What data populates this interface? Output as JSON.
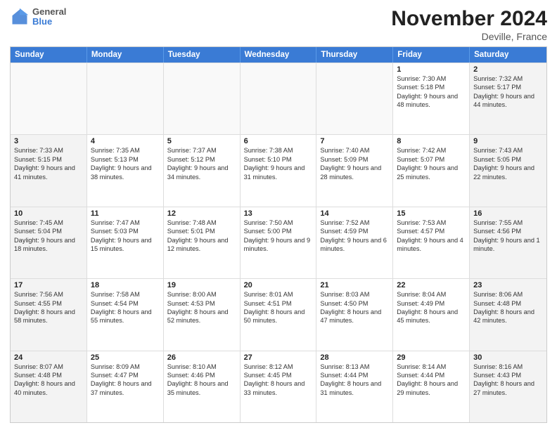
{
  "header": {
    "logo_line1": "General",
    "logo_line2": "Blue",
    "month": "November 2024",
    "location": "Deville, France"
  },
  "days_of_week": [
    "Sunday",
    "Monday",
    "Tuesday",
    "Wednesday",
    "Thursday",
    "Friday",
    "Saturday"
  ],
  "rows": [
    [
      {
        "day": "",
        "info": ""
      },
      {
        "day": "",
        "info": ""
      },
      {
        "day": "",
        "info": ""
      },
      {
        "day": "",
        "info": ""
      },
      {
        "day": "",
        "info": ""
      },
      {
        "day": "1",
        "info": "Sunrise: 7:30 AM\nSunset: 5:18 PM\nDaylight: 9 hours and 48 minutes."
      },
      {
        "day": "2",
        "info": "Sunrise: 7:32 AM\nSunset: 5:17 PM\nDaylight: 9 hours and 44 minutes."
      }
    ],
    [
      {
        "day": "3",
        "info": "Sunrise: 7:33 AM\nSunset: 5:15 PM\nDaylight: 9 hours and 41 minutes."
      },
      {
        "day": "4",
        "info": "Sunrise: 7:35 AM\nSunset: 5:13 PM\nDaylight: 9 hours and 38 minutes."
      },
      {
        "day": "5",
        "info": "Sunrise: 7:37 AM\nSunset: 5:12 PM\nDaylight: 9 hours and 34 minutes."
      },
      {
        "day": "6",
        "info": "Sunrise: 7:38 AM\nSunset: 5:10 PM\nDaylight: 9 hours and 31 minutes."
      },
      {
        "day": "7",
        "info": "Sunrise: 7:40 AM\nSunset: 5:09 PM\nDaylight: 9 hours and 28 minutes."
      },
      {
        "day": "8",
        "info": "Sunrise: 7:42 AM\nSunset: 5:07 PM\nDaylight: 9 hours and 25 minutes."
      },
      {
        "day": "9",
        "info": "Sunrise: 7:43 AM\nSunset: 5:05 PM\nDaylight: 9 hours and 22 minutes."
      }
    ],
    [
      {
        "day": "10",
        "info": "Sunrise: 7:45 AM\nSunset: 5:04 PM\nDaylight: 9 hours and 18 minutes."
      },
      {
        "day": "11",
        "info": "Sunrise: 7:47 AM\nSunset: 5:03 PM\nDaylight: 9 hours and 15 minutes."
      },
      {
        "day": "12",
        "info": "Sunrise: 7:48 AM\nSunset: 5:01 PM\nDaylight: 9 hours and 12 minutes."
      },
      {
        "day": "13",
        "info": "Sunrise: 7:50 AM\nSunset: 5:00 PM\nDaylight: 9 hours and 9 minutes."
      },
      {
        "day": "14",
        "info": "Sunrise: 7:52 AM\nSunset: 4:59 PM\nDaylight: 9 hours and 6 minutes."
      },
      {
        "day": "15",
        "info": "Sunrise: 7:53 AM\nSunset: 4:57 PM\nDaylight: 9 hours and 4 minutes."
      },
      {
        "day": "16",
        "info": "Sunrise: 7:55 AM\nSunset: 4:56 PM\nDaylight: 9 hours and 1 minute."
      }
    ],
    [
      {
        "day": "17",
        "info": "Sunrise: 7:56 AM\nSunset: 4:55 PM\nDaylight: 8 hours and 58 minutes."
      },
      {
        "day": "18",
        "info": "Sunrise: 7:58 AM\nSunset: 4:54 PM\nDaylight: 8 hours and 55 minutes."
      },
      {
        "day": "19",
        "info": "Sunrise: 8:00 AM\nSunset: 4:53 PM\nDaylight: 8 hours and 52 minutes."
      },
      {
        "day": "20",
        "info": "Sunrise: 8:01 AM\nSunset: 4:51 PM\nDaylight: 8 hours and 50 minutes."
      },
      {
        "day": "21",
        "info": "Sunrise: 8:03 AM\nSunset: 4:50 PM\nDaylight: 8 hours and 47 minutes."
      },
      {
        "day": "22",
        "info": "Sunrise: 8:04 AM\nSunset: 4:49 PM\nDaylight: 8 hours and 45 minutes."
      },
      {
        "day": "23",
        "info": "Sunrise: 8:06 AM\nSunset: 4:48 PM\nDaylight: 8 hours and 42 minutes."
      }
    ],
    [
      {
        "day": "24",
        "info": "Sunrise: 8:07 AM\nSunset: 4:48 PM\nDaylight: 8 hours and 40 minutes."
      },
      {
        "day": "25",
        "info": "Sunrise: 8:09 AM\nSunset: 4:47 PM\nDaylight: 8 hours and 37 minutes."
      },
      {
        "day": "26",
        "info": "Sunrise: 8:10 AM\nSunset: 4:46 PM\nDaylight: 8 hours and 35 minutes."
      },
      {
        "day": "27",
        "info": "Sunrise: 8:12 AM\nSunset: 4:45 PM\nDaylight: 8 hours and 33 minutes."
      },
      {
        "day": "28",
        "info": "Sunrise: 8:13 AM\nSunset: 4:44 PM\nDaylight: 8 hours and 31 minutes."
      },
      {
        "day": "29",
        "info": "Sunrise: 8:14 AM\nSunset: 4:44 PM\nDaylight: 8 hours and 29 minutes."
      },
      {
        "day": "30",
        "info": "Sunrise: 8:16 AM\nSunset: 4:43 PM\nDaylight: 8 hours and 27 minutes."
      }
    ]
  ]
}
